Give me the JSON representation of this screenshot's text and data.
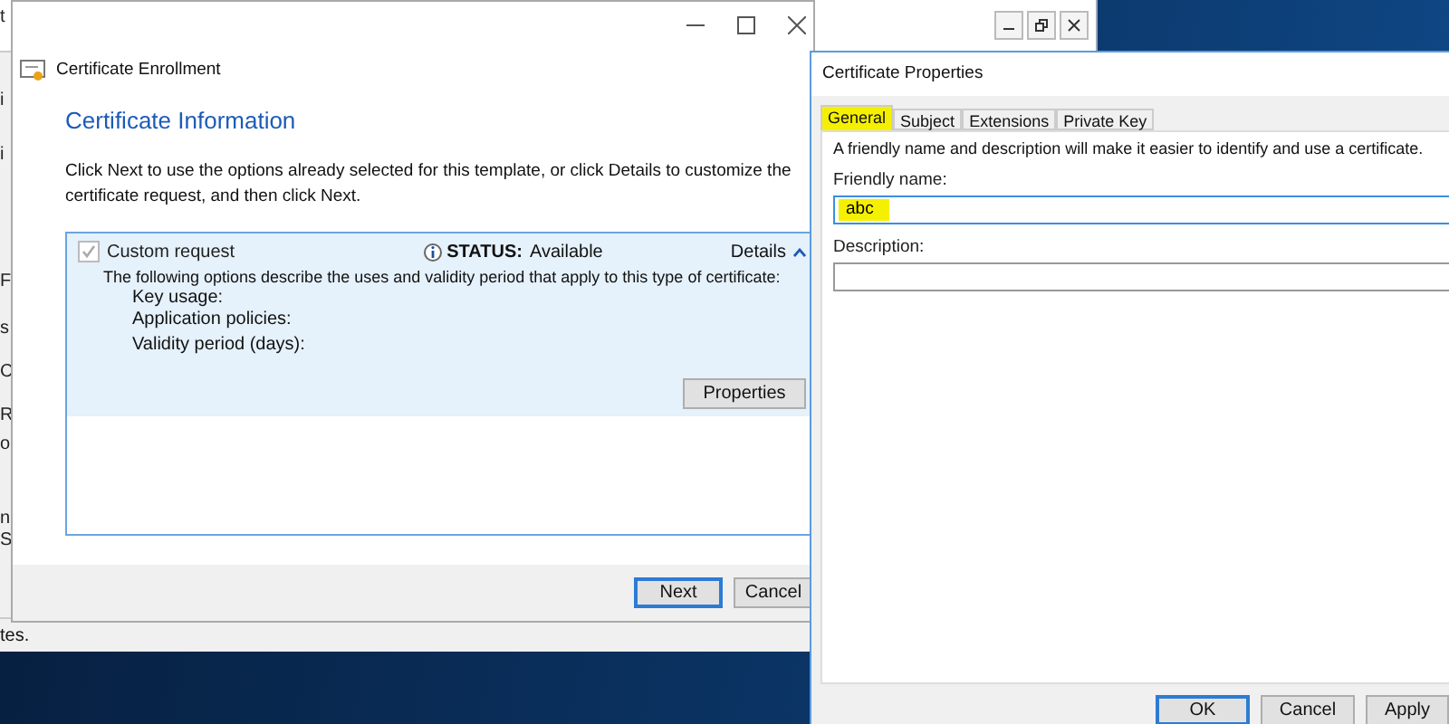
{
  "background_window": {
    "edge_fragments": [
      "t",
      "i",
      "i",
      "F",
      "s",
      "C",
      "R",
      "o",
      "n",
      "S"
    ],
    "status_bar": "tes."
  },
  "enrollment_window": {
    "title": "Certificate Enrollment",
    "heading": "Certificate Information",
    "instructions": "Click Next to use the options already selected for this template, or click Details to customize the certificate request, and then click Next.",
    "template": {
      "name": "Custom request",
      "checked": true,
      "disabled": true,
      "status_label": "STATUS:",
      "status": "Available",
      "details": "Details",
      "expanded": true,
      "description": "The following options describe the uses and validity period that apply to this type of certificate:",
      "fields": [
        "Key usage:",
        "Application policies:",
        "Validity period (days):"
      ],
      "properties_button": "Properties"
    },
    "buttons": [
      {
        "label": "Next",
        "default": true
      },
      {
        "label": "Cancel",
        "default": false
      }
    ]
  },
  "properties_window": {
    "title": "Certificate Properties",
    "tabs": [
      {
        "label": "General",
        "selected": true,
        "highlighted": true
      },
      {
        "label": "Subject",
        "selected": false,
        "highlighted": false
      },
      {
        "label": "Extensions",
        "selected": false,
        "highlighted": false
      },
      {
        "label": "Private Key",
        "selected": false,
        "highlighted": false
      }
    ],
    "intro": "A friendly name and description will make it easier to identify and use a certificate.",
    "fields": [
      {
        "label": "Friendly name:",
        "value": "abc",
        "focused": true,
        "highlighted": true
      },
      {
        "label": "Description:",
        "focused": false,
        "highlighted": false
      }
    ],
    "buttons": [
      {
        "label": "OK",
        "default": true
      },
      {
        "label": "Cancel",
        "default": false
      },
      {
        "label": "Apply",
        "default": false
      }
    ]
  }
}
